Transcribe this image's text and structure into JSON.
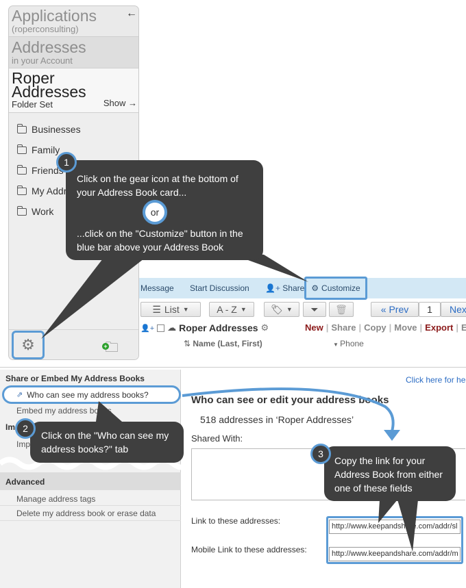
{
  "sidebar": {
    "apps_title": "Applications",
    "apps_sub": "(roperconsulting)",
    "addresses_title": "Addresses",
    "addresses_sub": "in your Account",
    "roper_title": "Roper Addresses",
    "folder_set": "Folder Set",
    "show_label": "Show →",
    "back_arrow": "←",
    "folders": [
      "Businesses",
      "Family",
      "Friends",
      "My Addr",
      "Work"
    ]
  },
  "callout1": {
    "number": "1",
    "line1": "Click on the gear icon at the bottom of your Address Book card...",
    "or_label": "or",
    "line2": "...click on the \"Customize\" button in the blue bar above your Address Book"
  },
  "toolbar": {
    "message": "Message",
    "start_discussion": "Start Discussion",
    "share": "Share",
    "customize": "Customize",
    "list": "List",
    "sort": "A - Z",
    "prev": "« Prev",
    "page": "1",
    "next": "Nex"
  },
  "addressbook": {
    "name": "Roper Addresses",
    "actions": [
      "New",
      "Share",
      "Copy",
      "Move",
      "Export",
      "E"
    ],
    "col_name": "Name (Last, First)",
    "col_phone": "Phone"
  },
  "share_panel": {
    "heading": "Share or Embed My Address Books",
    "tab_who": "Who can see my address books?",
    "tab_embed": "Embed my address books",
    "import_head": "Im",
    "import_item": "Imp",
    "advanced_head": "Advanced",
    "manage_tags": "Manage address tags",
    "delete_book": "Delete my address book or erase data",
    "click_here": "Click here for he",
    "main_title": "Who can see or edit your address books",
    "count_text": "518 addresses in ‘Roper Addresses’",
    "shared_with": "Shared With:",
    "link_label": "Link to these addresses:",
    "mobile_label": "Mobile Link to these addresses:",
    "link_value": "http://www.keepandshare.com/addr/sl",
    "mobile_value": "http://www.keepandshare.com/addr/m"
  },
  "callout2": {
    "number": "2",
    "text": "Click on the \"Who can see my address books?\" tab"
  },
  "callout3": {
    "number": "3",
    "text": "Copy the link for your Address Book from either one of these fields"
  },
  "colors": {
    "accent": "#5b9bd5",
    "callout_bg": "#3f3f3f",
    "blue_bar": "#d3e8f5",
    "action_red": "#8b1a1a"
  }
}
